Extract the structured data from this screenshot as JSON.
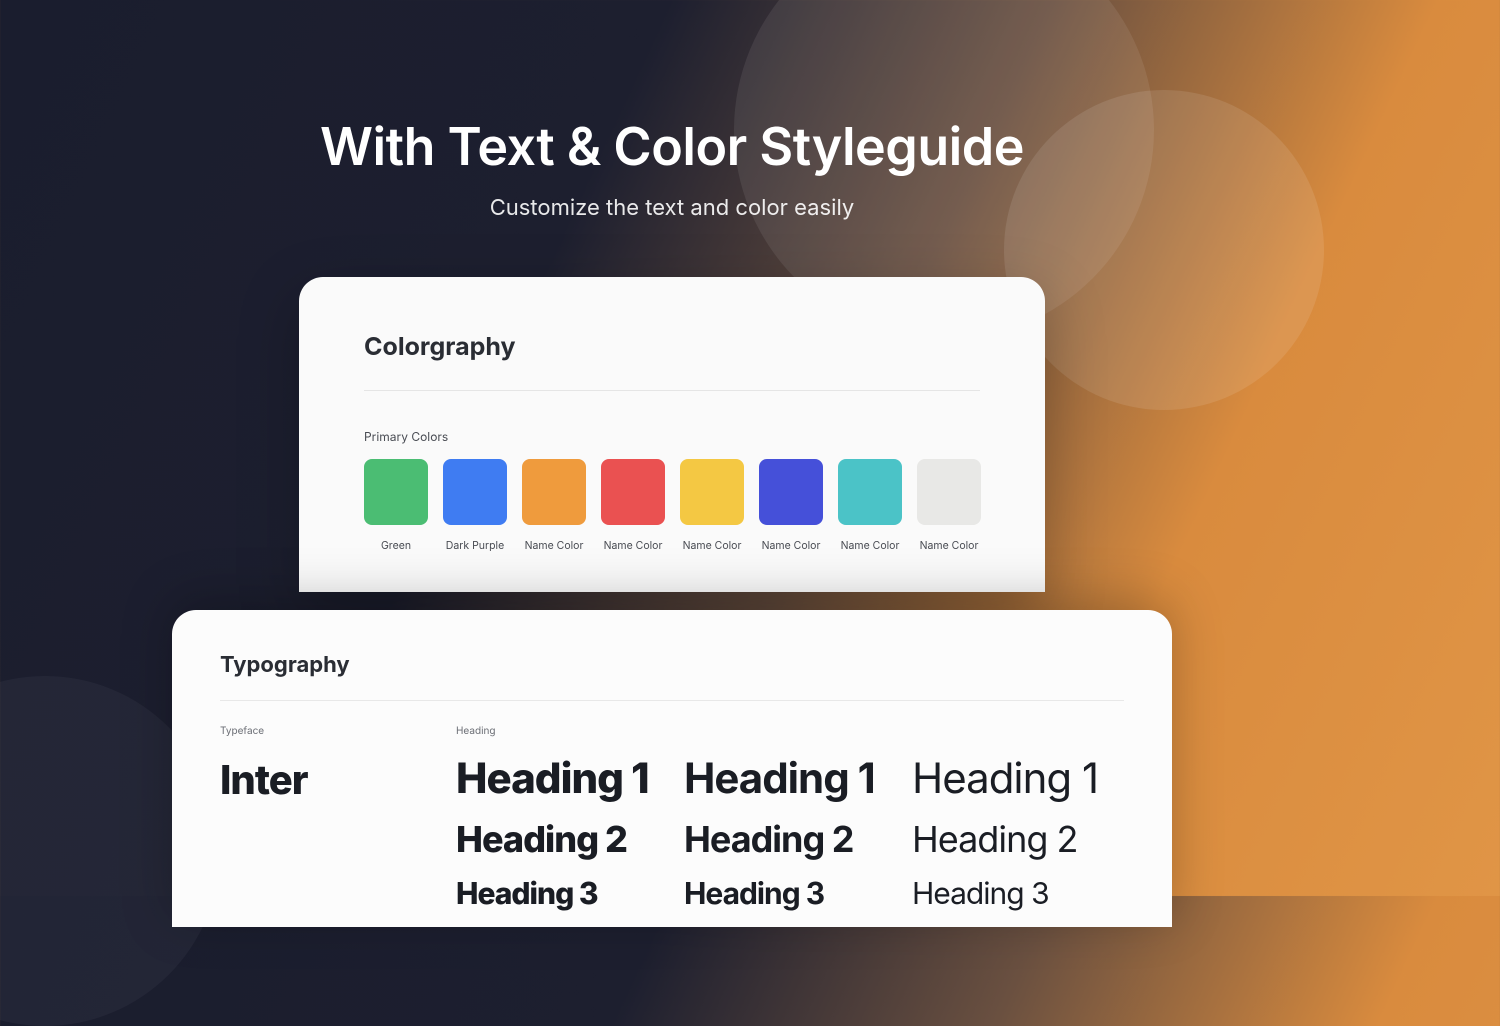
{
  "hero": {
    "title": "With Text & Color Styleguide",
    "subtitle": "Customize the text and color easily"
  },
  "color_card": {
    "title": "Colorgraphy",
    "subsection": "Primary Colors",
    "swatches": [
      {
        "name": "Green",
        "hex": "#4bbd73"
      },
      {
        "name": "Dark Purple",
        "hex": "#3f7cf2"
      },
      {
        "name": "Name Color",
        "hex": "#ef9b3d"
      },
      {
        "name": "Name Color",
        "hex": "#ea5151"
      },
      {
        "name": "Name Color",
        "hex": "#f4c843"
      },
      {
        "name": "Name Color",
        "hex": "#4550d9"
      },
      {
        "name": "Name Color",
        "hex": "#4bc3c7"
      },
      {
        "name": "Name Color",
        "hex": "#e8e8e6"
      }
    ]
  },
  "typo_card": {
    "title": "Typography",
    "typeface_label": "Typeface",
    "typeface_name": "Inter",
    "heading_label": "Heading",
    "columns": [
      {
        "weight": "bold",
        "rows": [
          "Heading 1",
          "Heading 2",
          "Heading 3"
        ]
      },
      {
        "weight": "semi",
        "rows": [
          "Heading 1",
          "Heading 2",
          "Heading 3"
        ]
      },
      {
        "weight": "regular",
        "rows": [
          "Heading 1",
          "Heading 2",
          "Heading 3"
        ]
      }
    ]
  }
}
